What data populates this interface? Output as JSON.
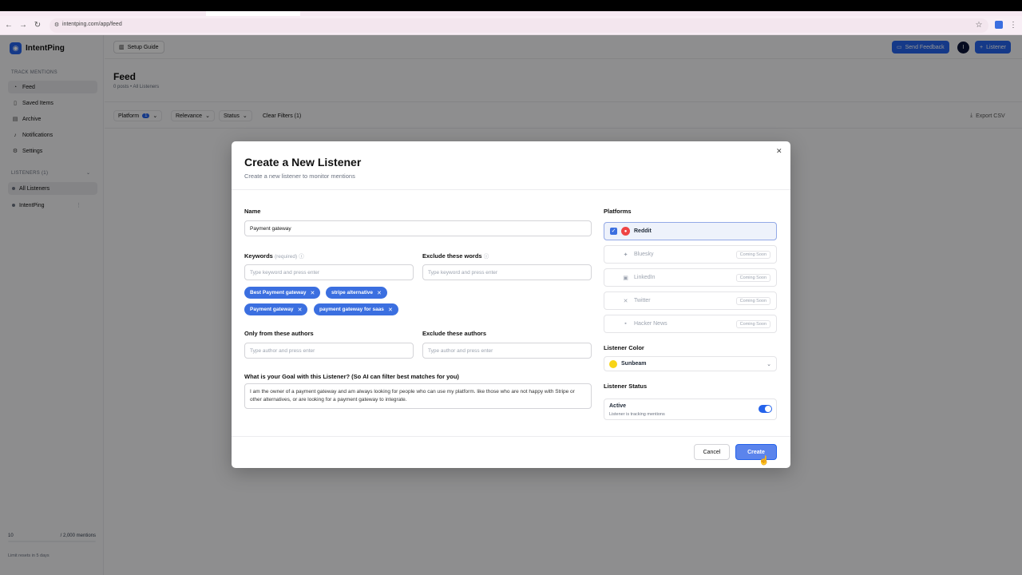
{
  "browser": {
    "url": "intentping.com/app/feed"
  },
  "app": {
    "brand": "IntentPing",
    "setup_guide": "Setup Guide",
    "send_feedback": "Send Feedback",
    "avatar_initial": "I",
    "add_listener": "Listener"
  },
  "sidebar": {
    "track_label": "TRACK MENTIONS",
    "items": [
      {
        "label": "Feed",
        "icon": "rss-icon"
      },
      {
        "label": "Saved Items",
        "icon": "bookmark-icon"
      },
      {
        "label": "Archive",
        "icon": "archive-icon"
      },
      {
        "label": "Notifications",
        "icon": "bell-icon"
      },
      {
        "label": "Settings",
        "icon": "gear-icon"
      }
    ],
    "listeners_label": "LISTENERS (1)",
    "listeners": [
      {
        "label": "All Listeners"
      },
      {
        "label": "IntentPing"
      }
    ],
    "usage": {
      "used": "10",
      "limit": "/ 2,000 mentions",
      "note": "Limit resets in 5 days"
    }
  },
  "main": {
    "title": "Feed",
    "subtitle": "0 posts • All Listeners",
    "filters": {
      "platform": "Platform",
      "platform_count": "1",
      "relevance": "Relevance",
      "status": "Status",
      "clear": "Clear Filters (1)",
      "export": "Export CSV"
    }
  },
  "modal": {
    "title": "Create a New Listener",
    "subtitle": "Create a new listener to monitor mentions",
    "name_label": "Name",
    "name_value": "Payment gateway",
    "keywords_label": "Keywords",
    "keywords_required": "(required)",
    "keywords_placeholder": "Type keyword and press enter",
    "exclude_words_label": "Exclude these  words",
    "exclude_words_placeholder": "Type keyword and press enter",
    "keywords": [
      "Best Payment gateway",
      "stripe alternative",
      "Payment gateway",
      "payment gateway for saas"
    ],
    "only_authors_label": "Only from these authors",
    "only_authors_placeholder": "Type author and press enter",
    "exclude_authors_label": "Exclude these authors",
    "exclude_authors_placeholder": "Type author and press enter",
    "goal_label": "What is your Goal with this Listener? (So AI can filter best matches for you)",
    "goal_value": "I am the owner of a payment gateway and am always looking for people who can use my platform. like those who are not happy with Stripe or other alternatives, or are looking for a payment gateway to integrate.",
    "platforms_label": "Platforms",
    "platforms": [
      {
        "name": "Reddit",
        "selected": true,
        "badge": ""
      },
      {
        "name": "Bluesky",
        "selected": false,
        "badge": "Coming Soon"
      },
      {
        "name": "LinkedIn",
        "selected": false,
        "badge": "Coming Soon"
      },
      {
        "name": "Twitter",
        "selected": false,
        "badge": "Coming Soon"
      },
      {
        "name": "Hacker News",
        "selected": false,
        "badge": "Coming Soon"
      }
    ],
    "color_label": "Listener Color",
    "color_value": "Sunbeam",
    "color_hex": "#f7d417",
    "status_label": "Listener Status",
    "status_title": "Active",
    "status_sub": "Listener is tracking mentions",
    "cancel": "Cancel",
    "create": "Create"
  },
  "colors": {
    "accent": "#2563eb"
  }
}
